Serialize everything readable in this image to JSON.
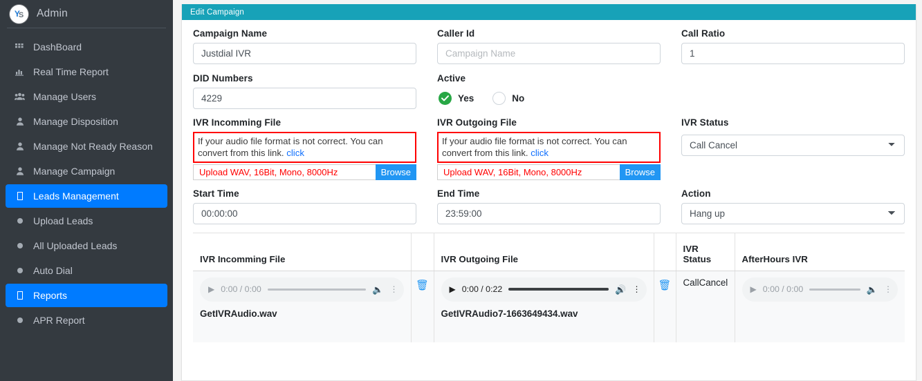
{
  "sidebar": {
    "brand": {
      "logo_text_1": "Y",
      "logo_text_2": "S",
      "title": "Admin"
    },
    "items": [
      {
        "label": "DashBoard",
        "icon": "grid-icon",
        "active": false
      },
      {
        "label": "Real Time Report",
        "icon": "bar-chart-icon",
        "active": false
      },
      {
        "label": "Manage Users",
        "icon": "users-icon",
        "active": false
      },
      {
        "label": "Manage Disposition",
        "icon": "user-icon",
        "active": false
      },
      {
        "label": "Manage Not Ready Reason",
        "icon": "user-icon",
        "active": false
      },
      {
        "label": "Manage Campaign",
        "icon": "user-icon",
        "active": false
      },
      {
        "label": "Leads Management",
        "icon": "box-glyph-icon",
        "active": true
      },
      {
        "label": "Upload Leads",
        "icon": "circle-icon",
        "active": false
      },
      {
        "label": "All Uploaded Leads",
        "icon": "circle-icon",
        "active": false
      },
      {
        "label": "Auto Dial",
        "icon": "circle-icon",
        "active": false
      },
      {
        "label": "Reports",
        "icon": "box-glyph-icon",
        "active": true
      },
      {
        "label": "APR Report",
        "icon": "circle-icon",
        "active": false
      }
    ]
  },
  "card": {
    "header_title": "Edit Campaign"
  },
  "form": {
    "campaign_name": {
      "label": "Campaign Name",
      "value": "Justdial IVR",
      "placeholder": "Campaign Name"
    },
    "caller_id": {
      "label": "Caller Id",
      "value": "",
      "placeholder": "Campaign Name"
    },
    "call_ratio": {
      "label": "Call Ratio",
      "value": "1",
      "placeholder": "Call Ratio"
    },
    "did_numbers": {
      "label": "DID Numbers",
      "value": "4229",
      "placeholder": "DID Numbers"
    },
    "active": {
      "label": "Active",
      "yes_label": "Yes",
      "no_label": "No",
      "selected": "Yes"
    },
    "ivr_incoming": {
      "label": "IVR Incomming File",
      "warning_text": "If your audio file format is not correct. You can convert from this link.",
      "warning_link": "click",
      "upload_hint": "Upload WAV, 16Bit, Mono, 8000Hz",
      "browse_label": "Browse"
    },
    "ivr_outgoing": {
      "label": "IVR Outgoing File",
      "warning_text": "If your audio file format is not correct. You can convert from this link.",
      "warning_link": "click",
      "upload_hint": "Upload WAV, 16Bit, Mono, 8000Hz",
      "browse_label": "Browse"
    },
    "ivr_status": {
      "label": "IVR Status",
      "value": "Call Cancel",
      "options": [
        "Call Cancel"
      ]
    },
    "start_time": {
      "label": "Start Time",
      "value": "00:00:00",
      "placeholder": "Start Time"
    },
    "end_time": {
      "label": "End Time",
      "value": "23:59:00",
      "placeholder": "End Time"
    },
    "action": {
      "label": "Action",
      "value": "Hang up",
      "options": [
        "Hang up"
      ]
    }
  },
  "table": {
    "headers": {
      "ivr_incoming": "IVR Incomming File",
      "blank_1": "",
      "ivr_outgoing": "IVR Outgoing File",
      "blank_2": "",
      "ivr_status": "IVR\nStatus",
      "ivr_status_line1": "IVR",
      "ivr_status_line2": "Status",
      "afterhours_ivr": "AfterHours IVR"
    },
    "row": {
      "incoming_player": {
        "current": "0:00",
        "duration": "0:00",
        "time_display": "0:00 / 0:00",
        "state": "idle"
      },
      "incoming_filename": "GetIVRAudio.wav",
      "delete_1_icon": "trash-icon",
      "outgoing_player": {
        "current": "0:00",
        "duration": "0:22",
        "time_display": "0:00 / 0:22",
        "state": "loaded"
      },
      "outgoing_filename": "GetIVRAudio7-1663649434.wav",
      "delete_2_icon": "trash-icon",
      "ivr_status_value": "CallCancel",
      "afterhours_player": {
        "current": "0:00",
        "duration": "0:00",
        "time_display": "0:00 / 0:00",
        "state": "idle"
      },
      "afterhours_filename": ""
    }
  },
  "colors": {
    "sidebar_bg": "#343a40",
    "sidebar_active": "#007bff",
    "card_header": "#17a2b8",
    "warning_border": "#ff0000",
    "browse_btn": "#2196f3",
    "radio_yes": "#28a745",
    "link": "#0d6efd"
  }
}
